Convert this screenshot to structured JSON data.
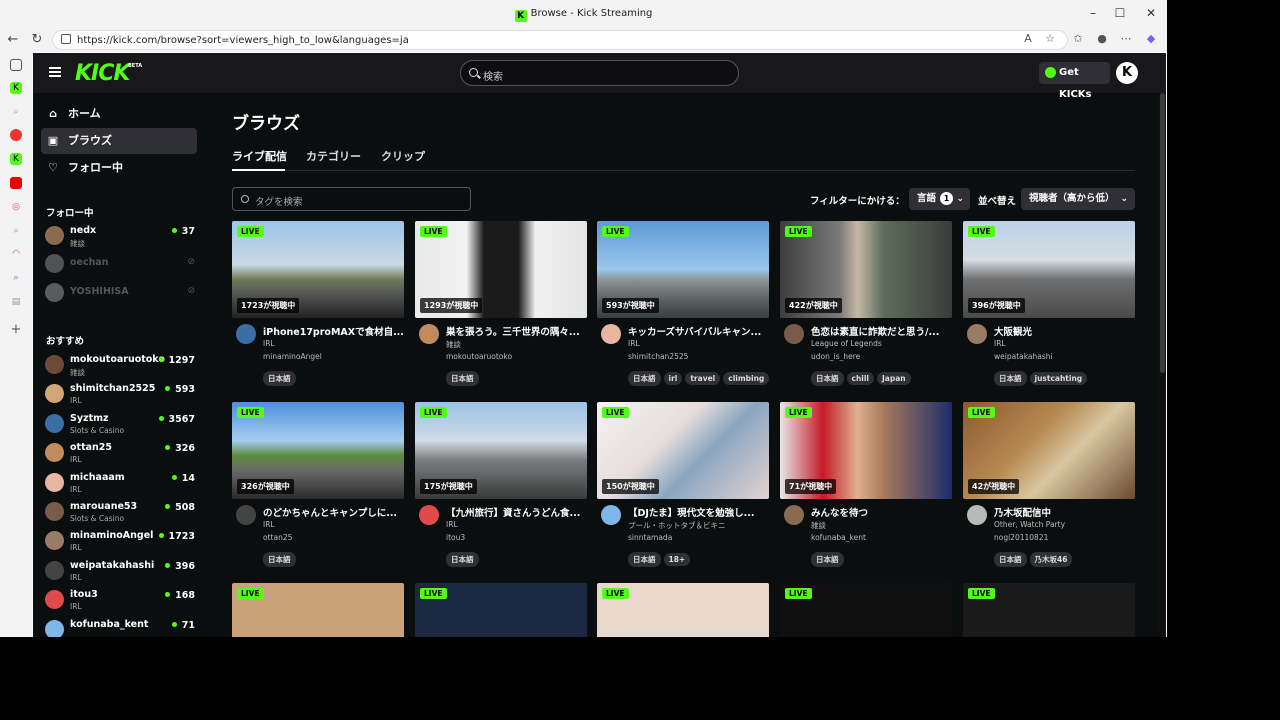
{
  "browser": {
    "window_title": "Browse - Kick Streaming",
    "url": "https://kick.com/browse?sort=viewers_high_to_low&languages=ja"
  },
  "header": {
    "logo": "KICK",
    "logo_badge": "BETA",
    "search_placeholder": "検索",
    "get_kicks": "Get KICKs",
    "avatar_letter": "K"
  },
  "sidebar": {
    "nav": [
      {
        "label": "ホーム",
        "icon": "home-icon",
        "glyph": "⌂"
      },
      {
        "label": "ブラウズ",
        "icon": "browse-icon",
        "glyph": "▣"
      },
      {
        "label": "フォロー中",
        "icon": "heart-icon",
        "glyph": "♡"
      }
    ],
    "following_heading": "フォロー中",
    "following": [
      {
        "name": "nedx",
        "category": "雑談",
        "viewers": "37",
        "online": true
      },
      {
        "name": "oechan",
        "online": false
      },
      {
        "name": "YOSHIHISA",
        "online": false
      }
    ],
    "recommended_heading": "おすすめ",
    "recommended": [
      {
        "name": "mokoutoaruotoko",
        "category": "雑談",
        "viewers": "1297"
      },
      {
        "name": "shimitchan2525",
        "category": "IRL",
        "viewers": "593"
      },
      {
        "name": "Syztmz",
        "category": "Slots & Casino",
        "viewers": "3567"
      },
      {
        "name": "ottan25",
        "category": "IRL",
        "viewers": "326"
      },
      {
        "name": "michaaam",
        "category": "IRL",
        "viewers": "14"
      },
      {
        "name": "marouane53",
        "category": "Slots & Casino",
        "viewers": "508"
      },
      {
        "name": "minaminoAngel",
        "category": "IRL",
        "viewers": "1723"
      },
      {
        "name": "weipatakahashi",
        "category": "IRL",
        "viewers": "396"
      },
      {
        "name": "itou3",
        "category": "IRL",
        "viewers": "168"
      },
      {
        "name": "kofunaba_kent",
        "category": "",
        "viewers": "71"
      }
    ]
  },
  "main": {
    "title": "ブラウズ",
    "tabs": [
      "ライブ配信",
      "カテゴリー",
      "クリップ"
    ],
    "tag_search_placeholder": "タグを検索",
    "filter_label": "フィルターにかける：",
    "language_label": "言語",
    "language_count": "1",
    "sort_label": "並べ替え",
    "sort_value": "視聴者（高から低）",
    "live_badge": "LIVE",
    "streams": [
      {
        "viewers": "1723が視聴中",
        "title": "iPhone17proMAXで食材自...",
        "category": "IRL",
        "user": "minaminoAngel",
        "tags": [
          "日本語"
        ]
      },
      {
        "viewers": "1293が視聴中",
        "title": "巣を張ろう。三千世界の隅々...",
        "category": "雑談",
        "user": "mokoutoaruotoko",
        "tags": [
          "日本語"
        ]
      },
      {
        "viewers": "593が視聴中",
        "title": "キッカーズサバイバルキャン...",
        "category": "IRL",
        "user": "shimitchan2525",
        "tags": [
          "日本語",
          "irl",
          "travel",
          "climbing"
        ]
      },
      {
        "viewers": "422が視聴中",
        "title": "色恋は素直に詐欺だと思う/...",
        "category": "League of Legends",
        "user": "udon_is_here",
        "tags": [
          "日本語",
          "chill",
          "Japan"
        ]
      },
      {
        "viewers": "396が視聴中",
        "title": "大阪観光",
        "category": "IRL",
        "user": "weipatakahashi",
        "tags": [
          "日本語",
          "justcahting"
        ]
      },
      {
        "viewers": "326が視聴中",
        "title": "のどかちゃんとキャンプしに...",
        "category": "IRL",
        "user": "ottan25",
        "tags": [
          "日本語"
        ]
      },
      {
        "viewers": "175が視聴中",
        "title": "【九州旅行】資さんうどん食...",
        "category": "IRL",
        "user": "itou3",
        "tags": [
          "日本語"
        ]
      },
      {
        "viewers": "150が視聴中",
        "title": "【DJたま】現代文を勉強し...",
        "category": "プール・ホットタブ＆ビキニ",
        "user": "sinntamada",
        "tags": [
          "日本語",
          "18+"
        ]
      },
      {
        "viewers": "71が視聴中",
        "title": "みんなを待つ",
        "category": "雑談",
        "user": "kofunaba_kent",
        "tags": [
          "日本語"
        ]
      },
      {
        "viewers": "42が視聴中",
        "title": "乃木坂配信中",
        "category": "Other, Watch Party",
        "user": "nogi20110821",
        "tags": [
          "日本語",
          "乃木坂46"
        ]
      }
    ]
  },
  "colors": {
    "accent": "#53fc18",
    "background": "#0b0e0f",
    "panel": "#18181b"
  }
}
